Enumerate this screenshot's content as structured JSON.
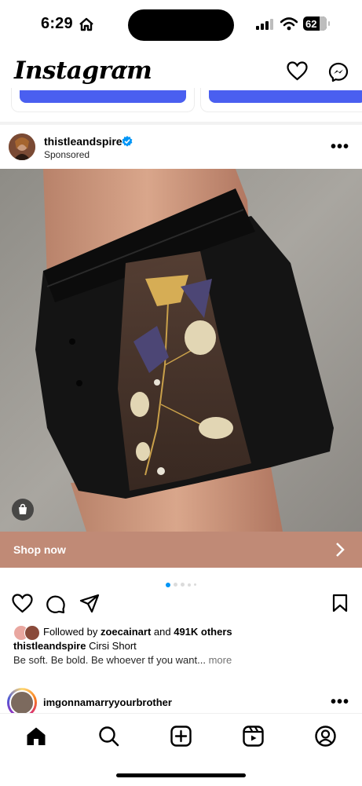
{
  "status_bar": {
    "time": "6:29",
    "battery": "62"
  },
  "header": {
    "logo": "Instagram"
  },
  "post": {
    "username": "thistleandspire",
    "sponsored_label": "Sponsored",
    "cta_label": "Shop now",
    "carousel": {
      "count": 5,
      "active_index": 0
    },
    "followed_prefix": "Followed by ",
    "followed_user": "zoecainart",
    "followed_and": " and ",
    "followed_count": "491K others",
    "caption_user": "thistleandspire",
    "caption_title": " Cirsi Short",
    "caption_text": "Be soft. Be bold. Be whoever tf you want...",
    "caption_more": " more"
  },
  "next_post": {
    "username": "imgonnamarryyourbrother"
  },
  "colors": {
    "accent": "#0095f6",
    "cta_bg": "#c08a76",
    "button_blue": "#4a5ff0"
  },
  "icons": {
    "header": [
      "heart-icon",
      "messenger-icon"
    ],
    "actions": [
      "like-icon",
      "comment-icon",
      "share-icon",
      "bookmark-icon"
    ],
    "nav": [
      "home-icon",
      "search-icon",
      "create-icon",
      "reels-icon",
      "profile-icon"
    ]
  }
}
